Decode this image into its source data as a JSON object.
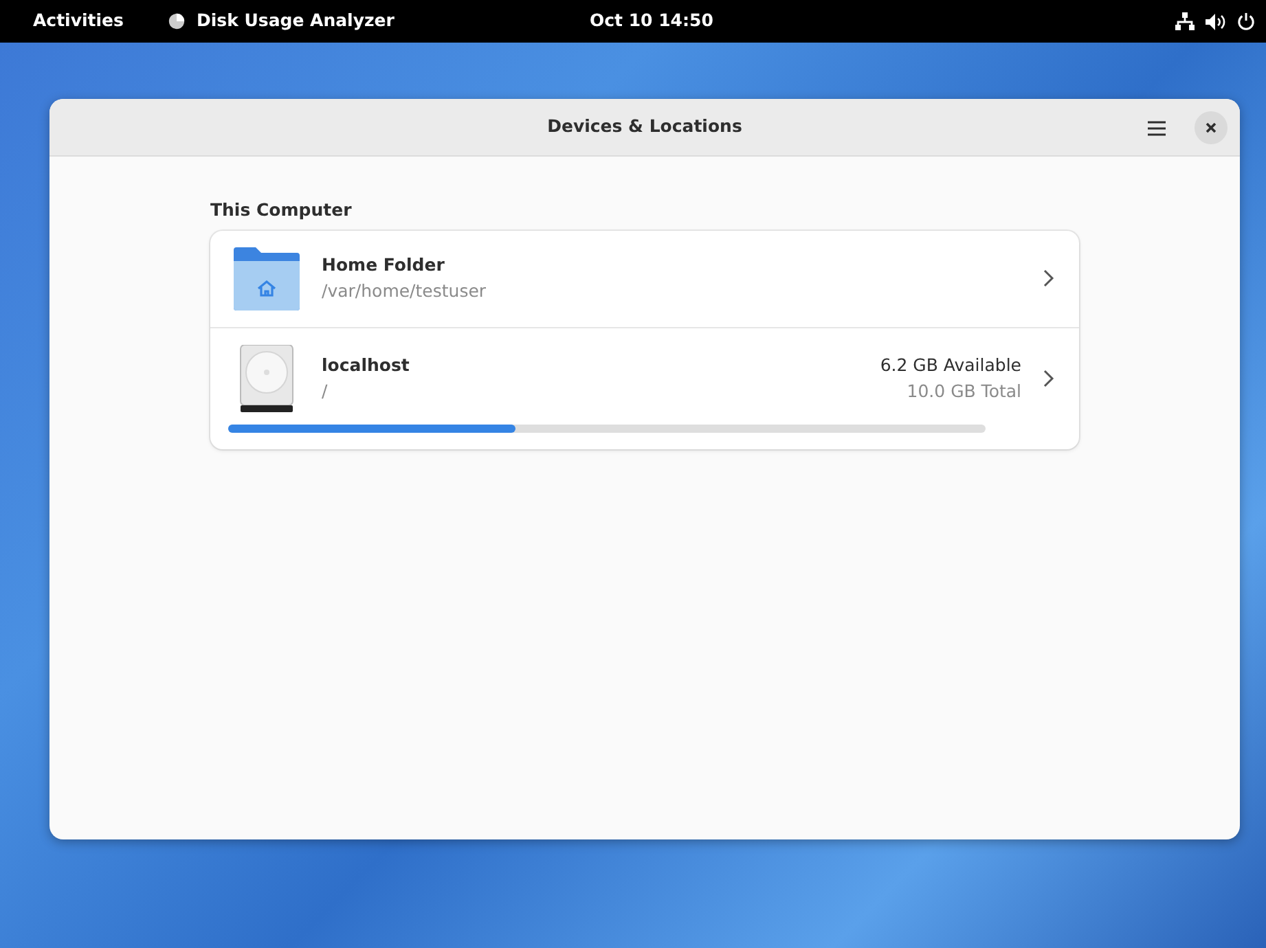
{
  "top_bar": {
    "activities": "Activities",
    "app_name": "Disk Usage Analyzer",
    "clock": "Oct 10  14:50"
  },
  "window": {
    "title": "Devices & Locations"
  },
  "section": {
    "title": "This Computer"
  },
  "locations": [
    {
      "kind": "folder",
      "name": "Home Folder",
      "path": "/var/home/testuser"
    },
    {
      "kind": "drive",
      "name": "localhost",
      "path": "/",
      "available": "6.2 GB Available",
      "total": "10.0 GB Total",
      "level": 0.38
    }
  ]
}
